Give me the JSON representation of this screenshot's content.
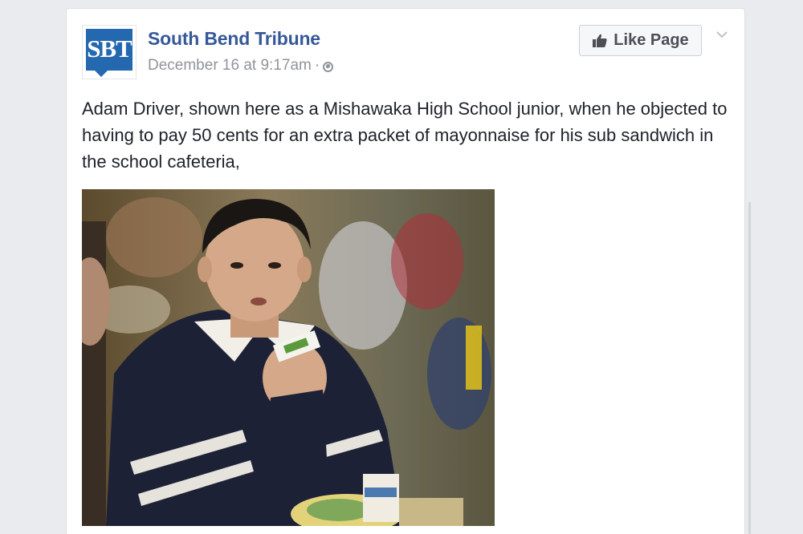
{
  "post": {
    "page_name": "South Bend Tribune",
    "avatar_text": "SBT",
    "timestamp": "December 16 at 9:17am",
    "separator": "·",
    "privacy_icon": "globe-icon",
    "like_button_label": "Like Page",
    "like_icon": "thumbs-up-icon",
    "menu_icon": "chevron-down-icon",
    "text": "Adam Driver, shown here as a Mishawaka High School junior, when he objected to having to pay 50 cents for an extra packet of mayonnaise for his sub sandwich in the school cafeteria,",
    "photo_description_icon": "photo"
  },
  "colors": {
    "brand_blue": "#365899",
    "logo_blue": "#2468b0",
    "meta_gray": "#90949c",
    "background": "#e9ebee"
  }
}
